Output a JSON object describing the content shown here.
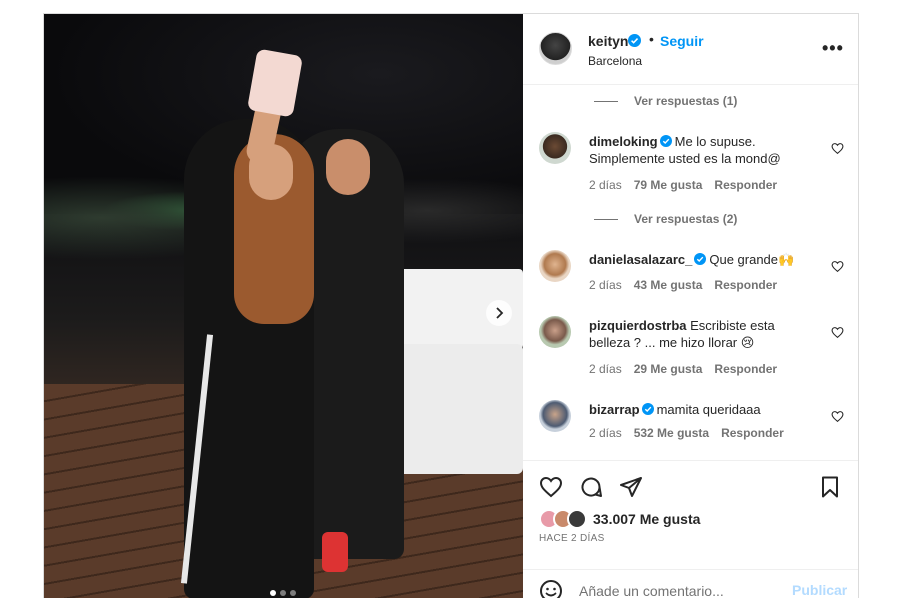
{
  "post": {
    "author": {
      "username": "keityn",
      "verified": true,
      "follow_label": "Seguir",
      "separator": "•",
      "location": "Barcelona"
    },
    "more_icon": "more-options-icon",
    "carousel": {
      "slides": 3,
      "active_index": 0
    }
  },
  "comments": {
    "view_replies_1": "Ver respuestas (1)",
    "view_replies_2": "Ver respuestas (2)",
    "items": [
      {
        "username": "dimeloking",
        "verified": true,
        "text": "Me lo supuse. Simplemente usted es la mond@",
        "age": "2 días",
        "likes": "79 Me gusta",
        "reply": "Responder"
      },
      {
        "username": "danielasalazarc_",
        "verified": true,
        "text": "Que grande🙌",
        "age": "2 días",
        "likes": "43 Me gusta",
        "reply": "Responder"
      },
      {
        "username": "pizquierdostrba",
        "verified": false,
        "text": "Escribiste esta belleza ? ... me hizo llorar 😢",
        "age": "2 días",
        "likes": "29 Me gusta",
        "reply": "Responder"
      },
      {
        "username": "bizarrap",
        "verified": true,
        "text": "mamita queridaaa",
        "age": "2 días",
        "likes": "532 Me gusta",
        "reply": "Responder"
      }
    ]
  },
  "actions": {
    "like_count": "33.007 Me gusta",
    "posted_ago": "HACE 2 DÍAS"
  },
  "composer": {
    "placeholder": "Añade un comentario...",
    "publish_label": "Publicar"
  },
  "colors": {
    "accent": "#0095f6",
    "publish_disabled": "#b3dbff",
    "text": "#262626",
    "muted": "#737373",
    "border": "#dbdbdb"
  }
}
